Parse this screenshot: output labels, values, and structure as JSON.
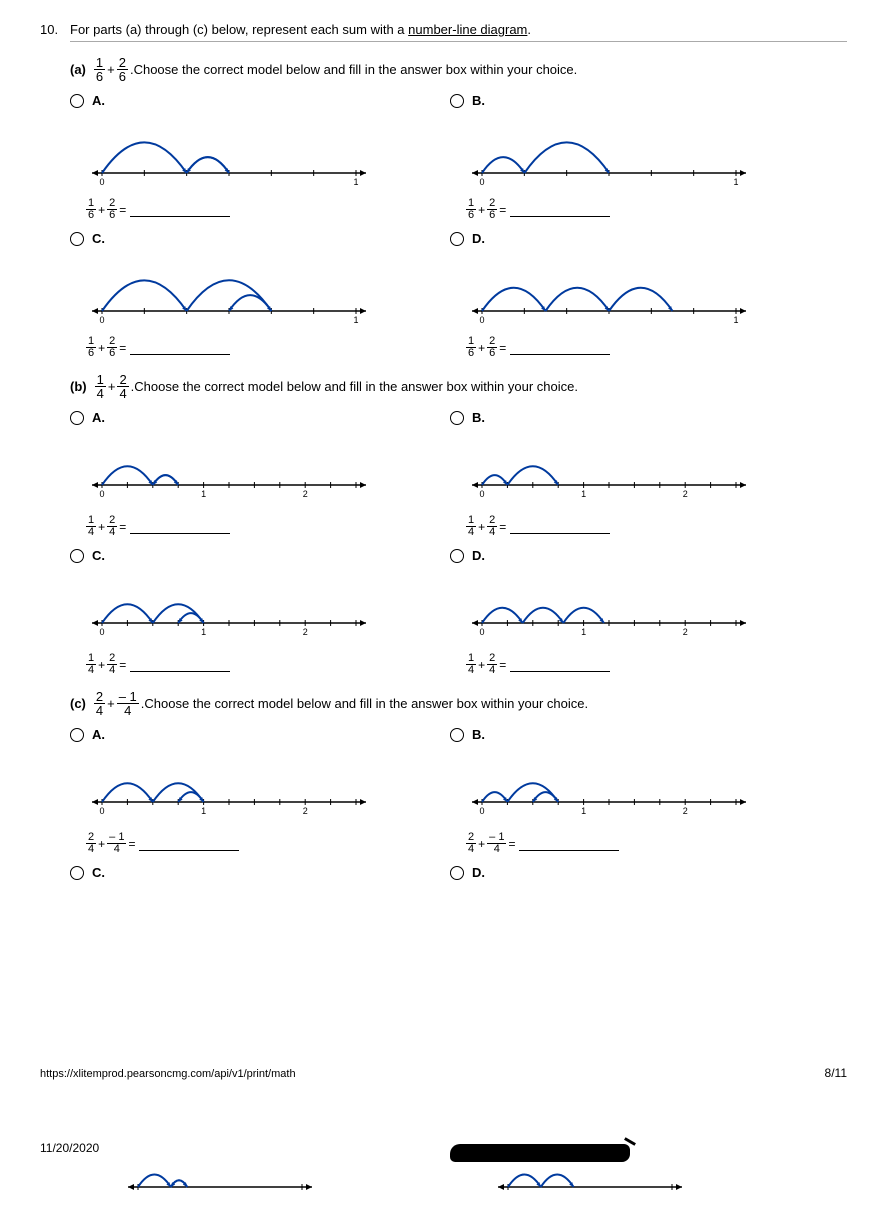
{
  "question": {
    "number": "10.",
    "intro_a": "For parts (a) through (c) below, represent each sum with a ",
    "intro_b": "number-line diagram",
    "intro_c": "."
  },
  "subq_instruction": "Choose the correct model below and fill in the answer box within your choice.",
  "labels": {
    "A": "A.",
    "B": "B.",
    "C": "C.",
    "D": "D."
  },
  "parts": {
    "a": {
      "label": "(a)",
      "f1n": "1",
      "f1d": "6",
      "op": "+",
      "f2n": "2",
      "f2d": "6"
    },
    "b": {
      "label": "(b)",
      "f1n": "1",
      "f1d": "4",
      "op": "+",
      "f2n": "2",
      "f2d": "4"
    },
    "c": {
      "label": "(c)",
      "f1n": "2",
      "f1d": "4",
      "op": "+",
      "f2n": "– 1",
      "f2d": "4"
    }
  },
  "axis": {
    "zero": "0",
    "one": "1",
    "two": "2"
  },
  "eq_a": {
    "f1n": "1",
    "f1d": "6",
    "op": "+",
    "f2n": "2",
    "f2d": "6",
    "eq": "="
  },
  "eq_b": {
    "f1n": "1",
    "f1d": "4",
    "op": "+",
    "f2n": "2",
    "f2d": "4",
    "eq": "="
  },
  "eq_c": {
    "f1n": "2",
    "f1d": "4",
    "op": "+",
    "f2n": "– 1",
    "f2d": "4",
    "eq": "="
  },
  "footer": {
    "url": "https://xlitemprod.pearsoncmg.com/api/v1/print/math",
    "pagenum": "8/11",
    "date": "11/20/2020"
  },
  "chart_data": [
    {
      "type": "line",
      "part": "a",
      "option": "A",
      "xlim": [
        0,
        1
      ],
      "ticks": 7,
      "arcs": [
        {
          "from": 0,
          "to": 0.333,
          "dir": 1
        },
        {
          "from": 0.333,
          "to": 0.5,
          "dir": 1
        },
        {
          "from": 0.5,
          "to": 0.333,
          "dir": -1
        }
      ]
    },
    {
      "type": "line",
      "part": "a",
      "option": "B",
      "xlim": [
        0,
        1
      ],
      "ticks": 7,
      "arcs": [
        {
          "from": 0,
          "to": 0.167,
          "dir": 1
        },
        {
          "from": 0.167,
          "to": 0.5,
          "dir": 1
        }
      ]
    },
    {
      "type": "line",
      "part": "a",
      "option": "C",
      "xlim": [
        0,
        1
      ],
      "ticks": 7,
      "arcs": [
        {
          "from": 0,
          "to": 0.333,
          "dir": 1
        },
        {
          "from": 0.333,
          "to": 0.667,
          "dir": 1
        },
        {
          "from": 0.667,
          "to": 0.5,
          "dir": -1
        }
      ]
    },
    {
      "type": "line",
      "part": "a",
      "option": "D",
      "xlim": [
        0,
        1
      ],
      "ticks": 7,
      "arcs": [
        {
          "from": 0,
          "to": 0.25,
          "dir": 1
        },
        {
          "from": 0.25,
          "to": 0.5,
          "dir": 1
        },
        {
          "from": 0.5,
          "to": 0.75,
          "dir": 1
        }
      ]
    },
    {
      "type": "line",
      "part": "b",
      "option": "A",
      "xlim": [
        0,
        2.5
      ],
      "ticks": 11,
      "arcs": [
        {
          "from": 0,
          "to": 0.5,
          "dir": 1
        },
        {
          "from": 0.5,
          "to": 0.75,
          "dir": 1
        },
        {
          "from": 0.75,
          "to": 0.5,
          "dir": -1
        }
      ]
    },
    {
      "type": "line",
      "part": "b",
      "option": "B",
      "xlim": [
        0,
        2.5
      ],
      "ticks": 11,
      "arcs": [
        {
          "from": 0,
          "to": 0.25,
          "dir": 1
        },
        {
          "from": 0.25,
          "to": 0.75,
          "dir": 1
        }
      ]
    },
    {
      "type": "line",
      "part": "b",
      "option": "C",
      "xlim": [
        0,
        2.5
      ],
      "ticks": 11,
      "arcs": [
        {
          "from": 0,
          "to": 0.5,
          "dir": 1
        },
        {
          "from": 0.5,
          "to": 1,
          "dir": 1
        },
        {
          "from": 1,
          "to": 0.75,
          "dir": -1
        }
      ]
    },
    {
      "type": "line",
      "part": "b",
      "option": "D",
      "xlim": [
        0,
        2.5
      ],
      "ticks": 11,
      "arcs": [
        {
          "from": 0,
          "to": 0.4,
          "dir": 1
        },
        {
          "from": 0.4,
          "to": 0.8,
          "dir": 1
        },
        {
          "from": 0.8,
          "to": 1.2,
          "dir": 1
        }
      ]
    },
    {
      "type": "line",
      "part": "c",
      "option": "A",
      "xlim": [
        0,
        2.5
      ],
      "ticks": 11,
      "arcs": [
        {
          "from": 0,
          "to": 0.5,
          "dir": 1
        },
        {
          "from": 0.5,
          "to": 1,
          "dir": 1
        },
        {
          "from": 1,
          "to": 0.75,
          "dir": -1
        }
      ]
    },
    {
      "type": "line",
      "part": "c",
      "option": "B",
      "xlim": [
        0,
        2.5
      ],
      "ticks": 11,
      "arcs": [
        {
          "from": 0,
          "to": 0.25,
          "dir": 1
        },
        {
          "from": 0.25,
          "to": 0.75,
          "dir": 1
        },
        {
          "from": 0.75,
          "to": 0.5,
          "dir": -1
        }
      ]
    }
  ]
}
